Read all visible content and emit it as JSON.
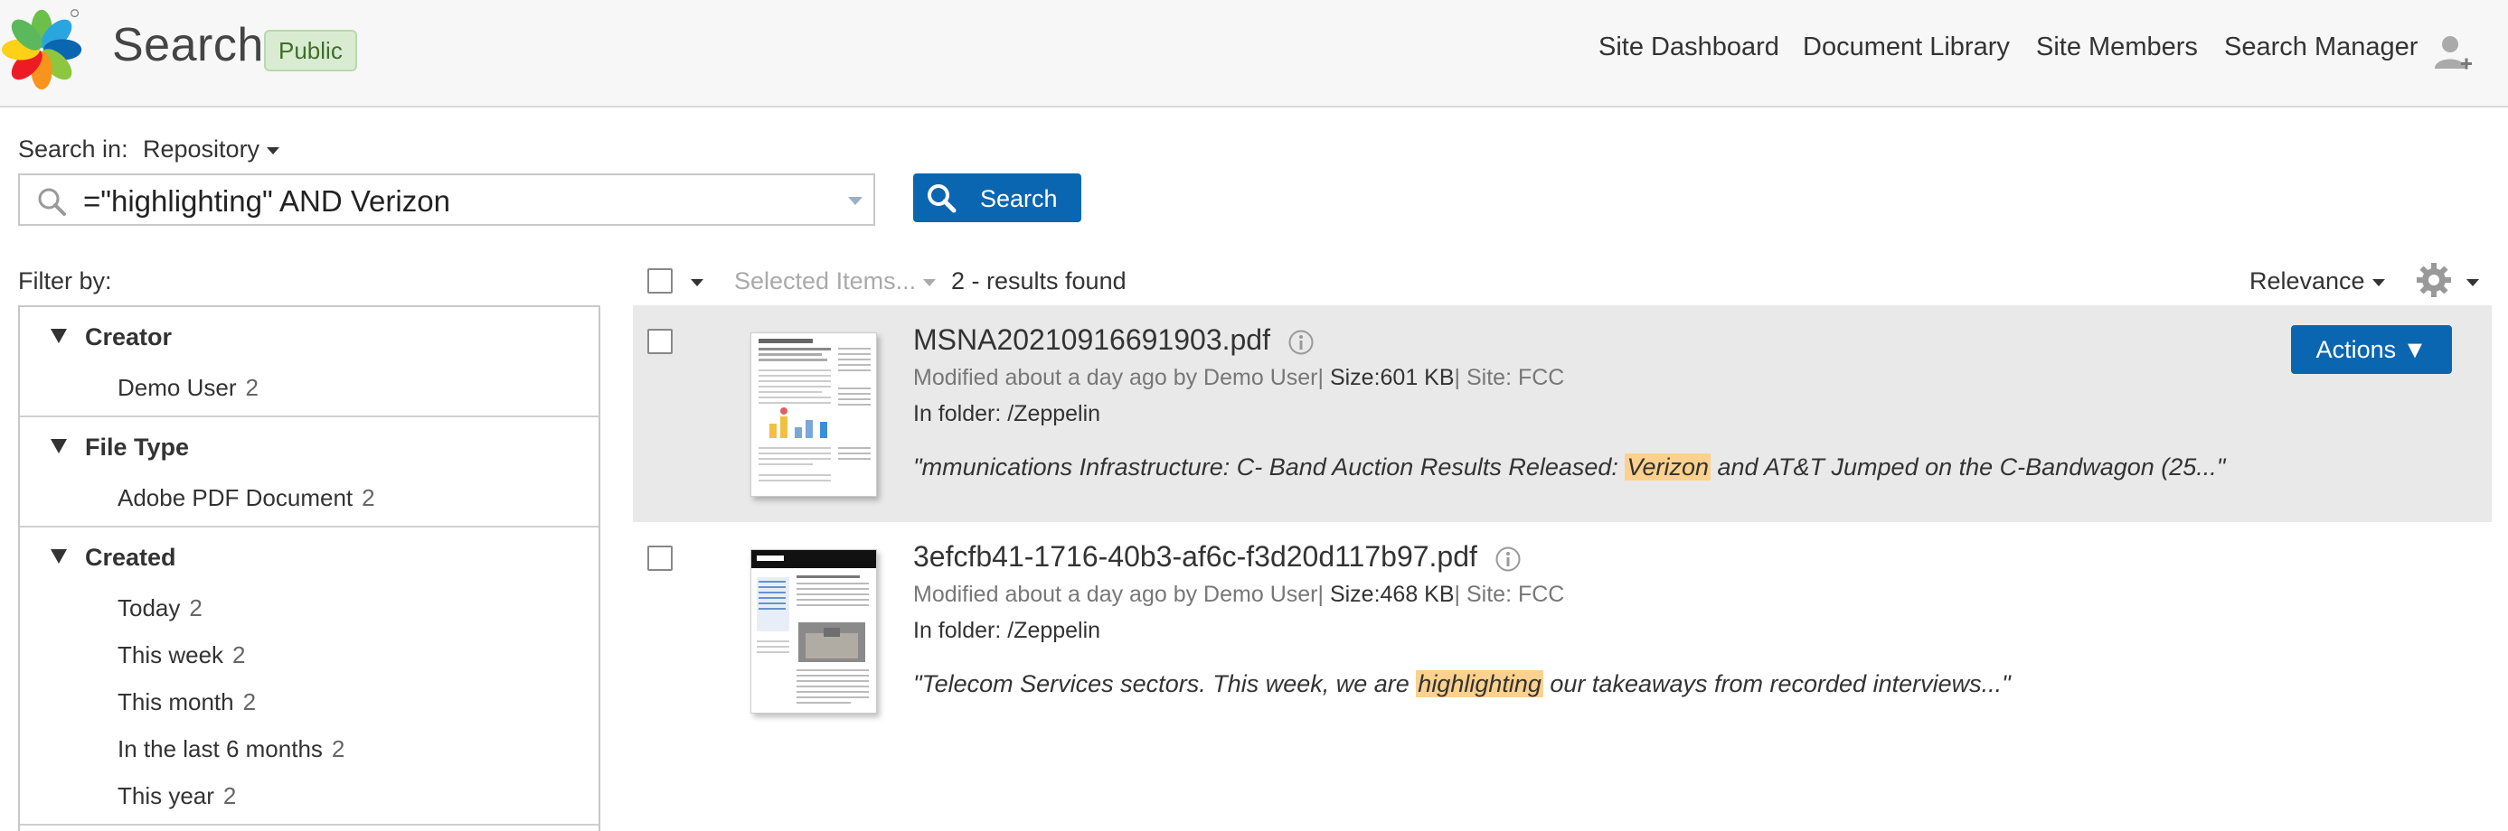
{
  "header": {
    "title": "Search",
    "badge": "Public",
    "nav": [
      "Site Dashboard",
      "Document Library",
      "Site Members",
      "Search Manager"
    ]
  },
  "search": {
    "scope_label": "Search in:",
    "scope_value": "Repository",
    "query": "=\"highlighting\" AND Verizon",
    "button_label": "Search"
  },
  "filters": {
    "label": "Filter by:",
    "facets": [
      {
        "name": "Creator",
        "items": [
          {
            "label": "Demo User",
            "count": "2"
          }
        ]
      },
      {
        "name": "File Type",
        "items": [
          {
            "label": "Adobe PDF Document",
            "count": "2"
          }
        ]
      },
      {
        "name": "Created",
        "items": [
          {
            "label": "Today",
            "count": "2"
          },
          {
            "label": "This week",
            "count": "2"
          },
          {
            "label": "This month",
            "count": "2"
          },
          {
            "label": "In the last 6 months",
            "count": "2"
          },
          {
            "label": "This year",
            "count": "2"
          }
        ]
      }
    ]
  },
  "toolbar": {
    "selected_items": "Selected Items...",
    "results_found": "2 - results found",
    "sort": "Relevance"
  },
  "results": [
    {
      "name": "MSNA20210916691903.pdf",
      "modified": "Modified about a day ago by Demo User",
      "size": "Size:601 KB",
      "site": "Site: FCC",
      "folder": "In folder: /Zeppelin",
      "snippet_before": "\"mmunications Infrastructure: C- Band Auction Results Released: ",
      "snippet_highlight": "Verizon",
      "snippet_after": " and AT&T Jumped on the C-Bandwagon (25...\"",
      "actions_label": "Actions ▼"
    },
    {
      "name": "3efcfb41-1716-40b3-af6c-f3d20d117b97.pdf",
      "modified": "Modified about a day ago by Demo User",
      "size": "Size:468 KB",
      "site": "Site: FCC",
      "folder": "In folder: /Zeppelin",
      "snippet_before": "\"Telecom Services sectors. This week, we are ",
      "snippet_highlight": "highlighting",
      "snippet_after": " our takeaways from recorded interviews...\""
    }
  ],
  "colors": {
    "primary": "#0b66b1",
    "highlight": "#fbd18d",
    "badge_bg": "#d9ecd2",
    "selected_row": "#e9e9e9"
  }
}
